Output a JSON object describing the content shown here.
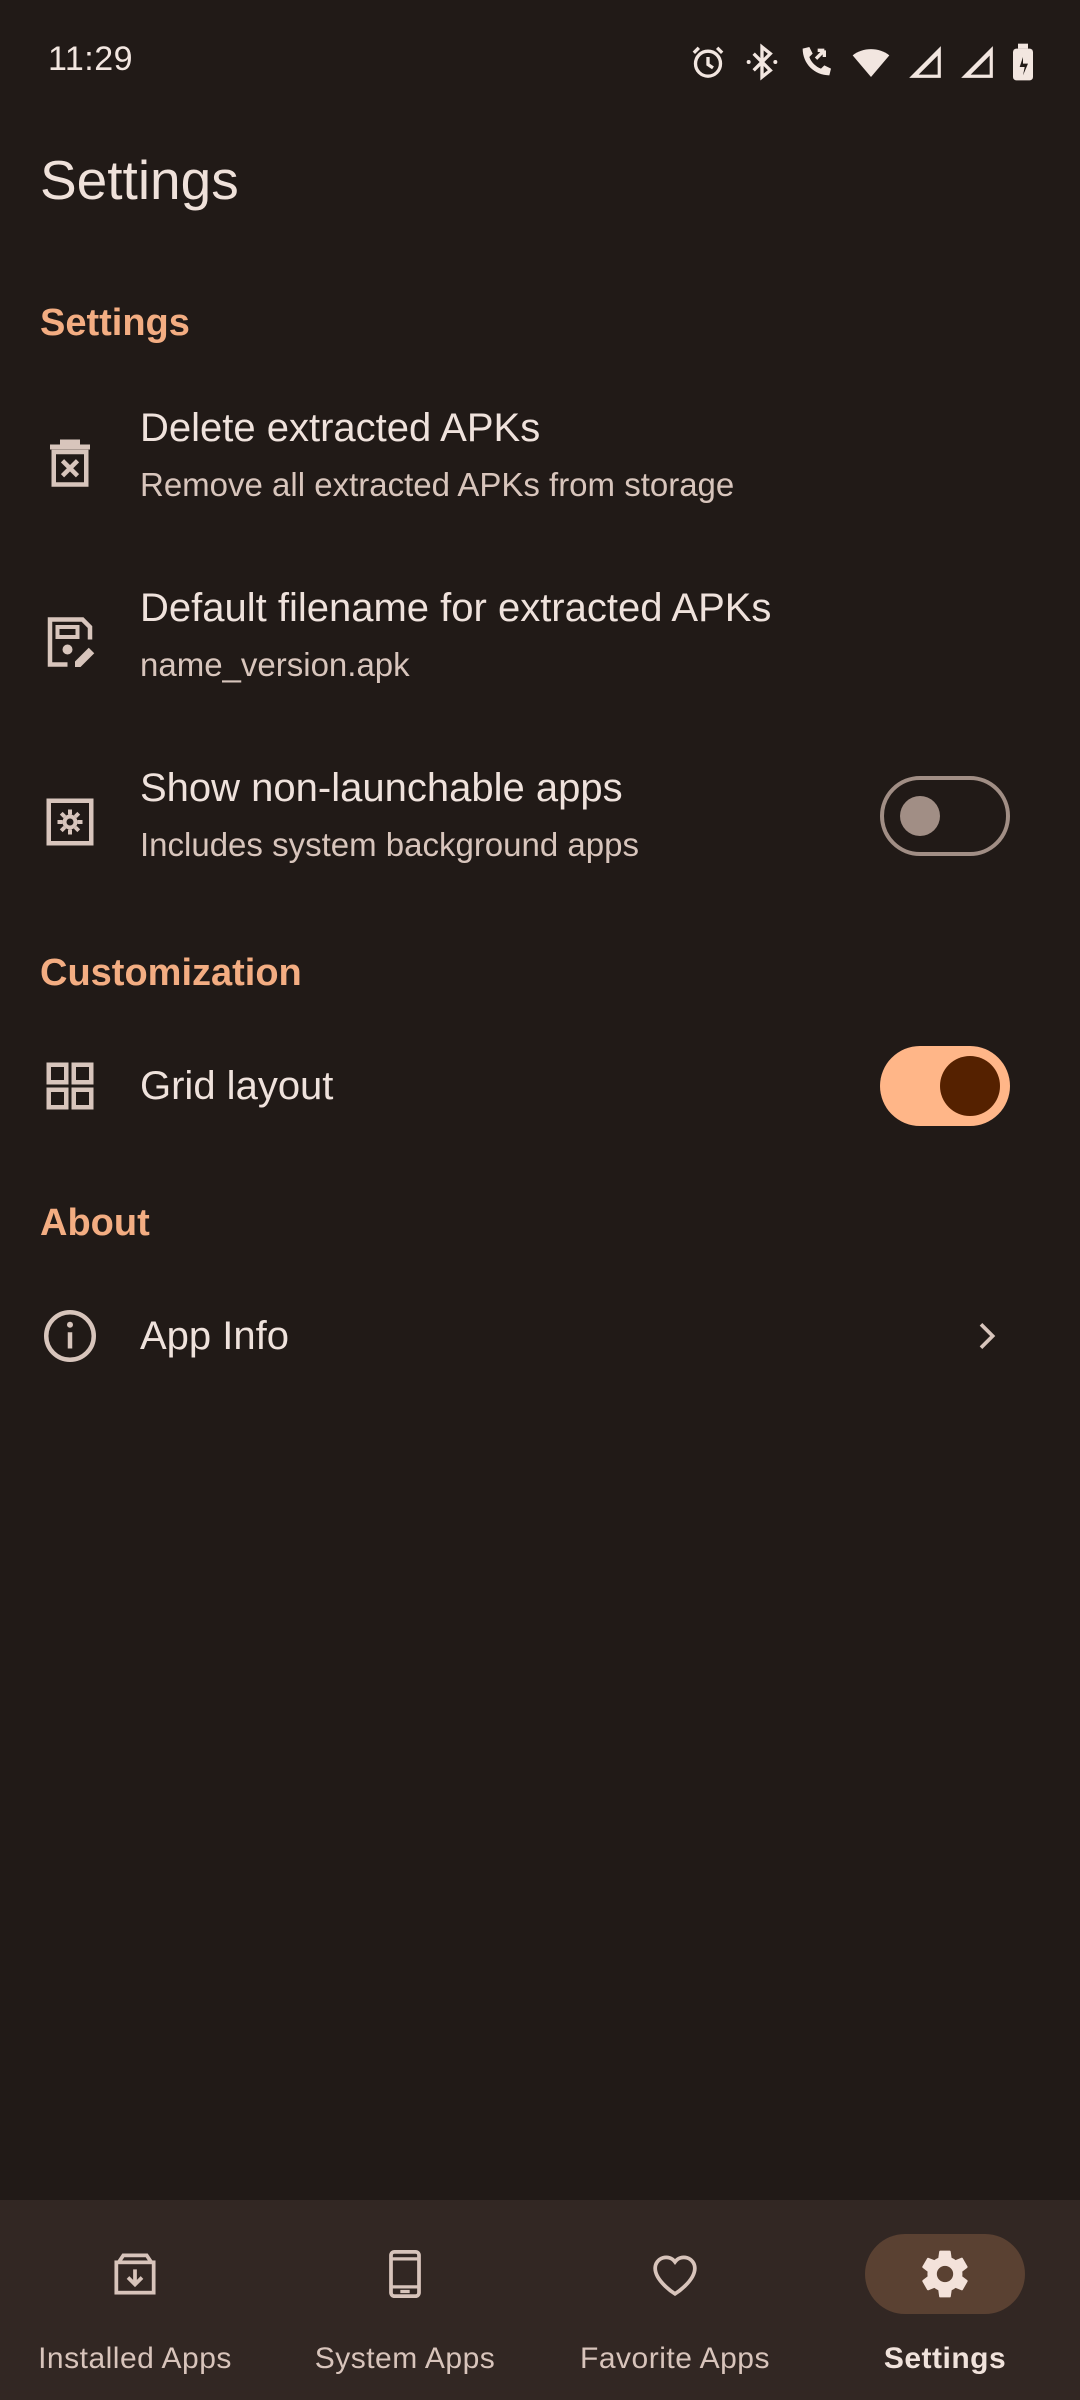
{
  "status_bar": {
    "time": "11:29",
    "icons": [
      "alarm-icon",
      "bluetooth-icon",
      "wifi-calling-icon",
      "wifi-icon",
      "signal-icon",
      "signal-icon",
      "battery-icon"
    ]
  },
  "header": {
    "title": "Settings"
  },
  "sections": {
    "settings": {
      "header": "Settings",
      "delete_apks": {
        "icon": "delete-box-icon",
        "title": "Delete extracted APKs",
        "subtitle": "Remove all extracted APKs from storage"
      },
      "default_filename": {
        "icon": "file-edit-icon",
        "title": "Default filename for extracted APKs",
        "subtitle": "name_version.apk"
      },
      "non_launchable": {
        "icon": "settings-box-icon",
        "title": "Show non-launchable apps",
        "subtitle": "Includes system background apps",
        "enabled": false
      }
    },
    "customization": {
      "header": "Customization",
      "grid_layout": {
        "icon": "grid-icon",
        "title": "Grid layout",
        "enabled": true
      }
    },
    "about": {
      "header": "About",
      "app_info": {
        "icon": "info-icon",
        "title": "App Info"
      }
    }
  },
  "bottom_nav": {
    "items": [
      {
        "label": "Installed Apps",
        "icon": "download-box-icon",
        "active": false
      },
      {
        "label": "System Apps",
        "icon": "phone-icon",
        "active": false
      },
      {
        "label": "Favorite Apps",
        "icon": "heart-icon",
        "active": false
      },
      {
        "label": "Settings",
        "icon": "gear-icon",
        "active": true
      }
    ]
  },
  "colors": {
    "background": "#211a17",
    "accent": "#ffb688",
    "section_header": "#f3ad82",
    "nav_background": "#322723",
    "nav_active_pill": "#5a4132"
  }
}
